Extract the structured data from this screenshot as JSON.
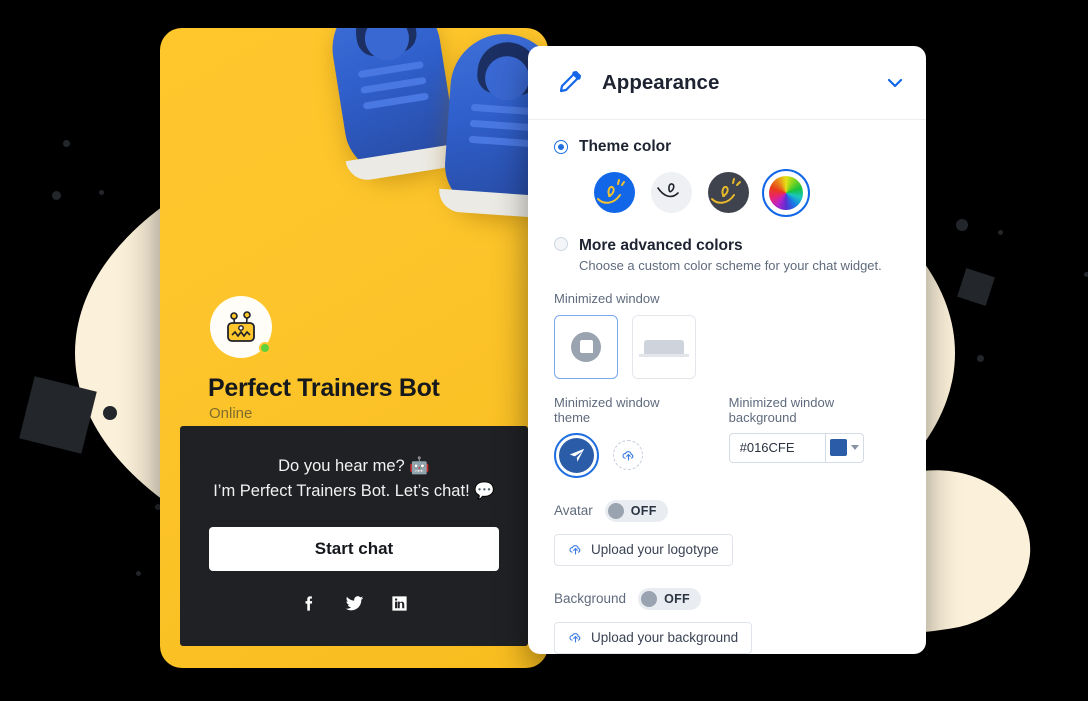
{
  "widget": {
    "bot_name": "Perfect Trainers Bot",
    "status": "Online",
    "greeting_line_1": "Do you hear me? 🤖",
    "greeting_line_2": "I’m Perfect Trainers Bot. Let’s chat! 💬",
    "start_chat_label": "Start chat",
    "socials": [
      {
        "name": "facebook-icon"
      },
      {
        "name": "twitter-icon"
      },
      {
        "name": "linkedin-icon"
      }
    ],
    "avatar_icon": "robot-avatar-icon",
    "hero_image": "blue-sneakers-photo"
  },
  "panel": {
    "header": {
      "icon": "pencil-icon",
      "title": "Appearance",
      "collapse_icon": "chevron-down-icon"
    },
    "theme_color": {
      "label": "Theme color",
      "selected": true,
      "swatches": [
        {
          "name": "theme-swatch-blue",
          "color": "#1167E8",
          "selected": false
        },
        {
          "name": "theme-swatch-light",
          "color": "#EEF0F4",
          "selected": false
        },
        {
          "name": "theme-swatch-dark",
          "color": "#3E434D",
          "selected": false
        },
        {
          "name": "theme-swatch-rainbow",
          "color": "rainbow",
          "selected": true
        }
      ]
    },
    "advanced_colors": {
      "label": "More advanced colors",
      "description": "Choose a custom color scheme for your chat widget.",
      "selected": false
    },
    "minimized_window": {
      "label": "Minimized window",
      "options": [
        {
          "name": "minimized-window-bubble",
          "selected": true
        },
        {
          "name": "minimized-window-bar",
          "selected": false
        }
      ]
    },
    "minimized_window_theme": {
      "label": "Minimized window theme",
      "options": [
        {
          "name": "theme-paper-plane",
          "selected": true
        },
        {
          "name": "theme-upload-custom",
          "selected": false
        }
      ]
    },
    "minimized_window_background": {
      "label": "Minimized window background",
      "hex_value": "#016CFE",
      "swatch_color": "#2A5CA8"
    },
    "avatar": {
      "label": "Avatar",
      "state": "OFF",
      "upload_label": "Upload your logotype",
      "upload_icon": "cloud-upload-icon"
    },
    "background": {
      "label": "Background",
      "state": "OFF",
      "upload_label": "Upload your background",
      "upload_icon": "cloud-upload-icon"
    }
  },
  "colors": {
    "accent": "#1167E8",
    "widget_yellow": "#FFC72C",
    "chat_dark": "#202124",
    "page_black": "#000000",
    "blob_cream": "#FBF0D9",
    "online_green": "#5FD13A"
  }
}
